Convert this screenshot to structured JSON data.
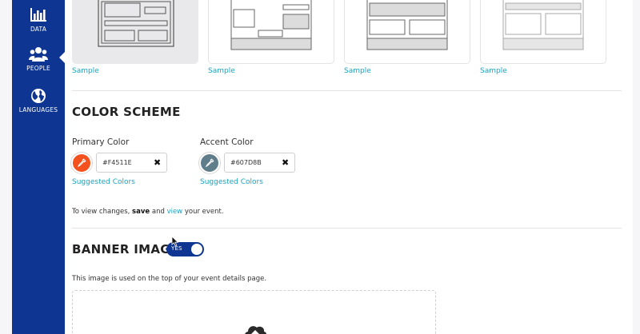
{
  "sidebar": {
    "items": [
      {
        "label": "DATA",
        "icon": "bar-chart-icon"
      },
      {
        "label": "PEOPLE",
        "icon": "people-icon",
        "active": true
      },
      {
        "label": "LANGUAGES",
        "icon": "globe-icon"
      }
    ]
  },
  "layouts": {
    "sample_label": "Sample",
    "cards": [
      {
        "selected": true
      },
      {
        "selected": false
      },
      {
        "selected": false
      },
      {
        "selected": false
      }
    ]
  },
  "color_scheme": {
    "title": "COLOR SCHEME",
    "primary": {
      "label": "Primary Color",
      "value": "#F4511E",
      "swatch": "#f4511e"
    },
    "accent": {
      "label": "Accent Color",
      "value": "#607D8B",
      "swatch": "#607d8b"
    },
    "suggested_label": "Suggested Colors",
    "help_prefix": "To view changes,",
    "help_save": "save",
    "help_and": "and",
    "help_view": "view",
    "help_suffix": "your event."
  },
  "banner": {
    "title": "BANNER IMAGE",
    "toggle_label": "YES",
    "toggle_on": true,
    "description": "This image is used on the top of your event details page."
  },
  "colors": {
    "sidebar": "#0d3591",
    "link": "#1aa3c0"
  }
}
